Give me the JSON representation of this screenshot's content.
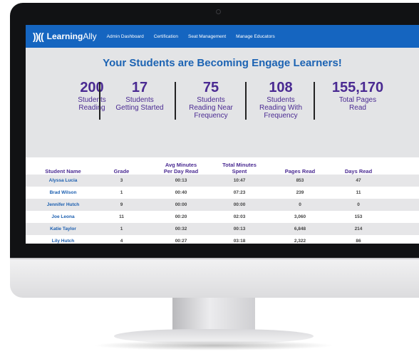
{
  "nav": {
    "logo_mark": "))((",
    "logo_bold": "Learning",
    "logo_thin": "Ally",
    "links": [
      "Admin Dashboard",
      "Certification",
      "Seat Management",
      "Manage Educators"
    ]
  },
  "hero": {
    "title": "Your Students are Becoming Engage Learners!",
    "stats": [
      {
        "value": "200",
        "label_lines": [
          "Students",
          "Reading"
        ]
      },
      {
        "value": "17",
        "label_lines": [
          "Students",
          "Getting Started"
        ]
      },
      {
        "value": "75",
        "label_lines": [
          "Students",
          "Reading Near",
          "Frequency"
        ]
      },
      {
        "value": "108",
        "label_lines": [
          "Students",
          "Reading With",
          "Frequency"
        ]
      },
      {
        "value": "155,170",
        "label_lines": [
          "Total Pages",
          "Read"
        ]
      }
    ]
  },
  "table": {
    "headers": [
      [
        "Student Name"
      ],
      [
        "Grade"
      ],
      [
        "Avg Minutes",
        "Per Day Read"
      ],
      [
        "Total Minutes",
        "Spent"
      ],
      [
        "Pages Read"
      ],
      [
        "Days Read"
      ]
    ],
    "rows": [
      [
        "Alyssa Lucia",
        "3",
        "00:13",
        "10:47",
        "853",
        "47"
      ],
      [
        "Brad Wilson",
        "1",
        "00:40",
        "07:23",
        "239",
        "11"
      ],
      [
        "Jennifer Hutch",
        "9",
        "00:00",
        "00:00",
        "0",
        "0"
      ],
      [
        "Joe Leona",
        "11",
        "00:20",
        "02:03",
        "3,060",
        "153"
      ],
      [
        "Katie Taylor",
        "1",
        "00:32",
        "00:13",
        "6,848",
        "214"
      ],
      [
        "Lily Hutch",
        "4",
        "00:27",
        "03:18",
        "2,322",
        "86"
      ]
    ]
  },
  "colors": {
    "nav_bg": "#1565c0",
    "title": "#1c63b3",
    "stat_text": "#4a2a92",
    "row_shade": "#e6e6e8",
    "bezel": "#111214"
  }
}
